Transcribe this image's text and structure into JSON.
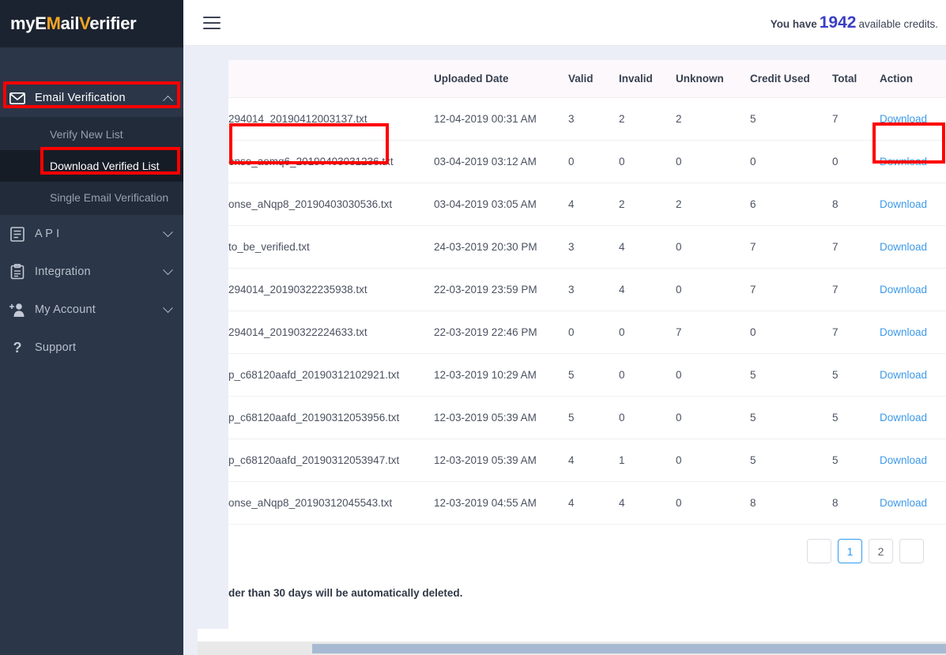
{
  "brand": {
    "logo_part1": "myE",
    "logo_accent1": "M",
    "logo_part2": "ail",
    "logo_accent2": "V",
    "logo_part3": "erifier",
    "logo_full": "myEMailVerifier"
  },
  "sidebar": {
    "items": [
      {
        "label": "Email Verification",
        "icon": "mail-icon",
        "caret": "chevron-up-icon",
        "expanded": true
      },
      {
        "label": "A P I",
        "icon": "document-icon",
        "caret": "chevron-down-icon",
        "expanded": false
      },
      {
        "label": "Integration",
        "icon": "clipboard-icon",
        "caret": "chevron-down-icon",
        "expanded": false
      },
      {
        "label": "My Account",
        "icon": "add-user-icon",
        "caret": "chevron-down-icon",
        "expanded": false
      },
      {
        "label": "Support",
        "icon": "question-mark-icon",
        "caret": "",
        "expanded": false
      }
    ],
    "submenu": [
      {
        "label": "Verify New List",
        "selected": false
      },
      {
        "label": "Download Verified List",
        "selected": true
      },
      {
        "label": "Single Email Verification",
        "selected": false
      }
    ]
  },
  "topbar": {
    "menu_icon": "hamburger-icon",
    "credits_prefix": "You have",
    "credits_count": "1942",
    "credits_suffix": "available credits."
  },
  "table": {
    "columns": [
      "",
      "Uploaded Date",
      "Valid",
      "Invalid",
      "Unknown",
      "Credit Used",
      "Total",
      "Action"
    ],
    "action_label": "Download",
    "rows": [
      {
        "file": "294014_20190412003137.txt",
        "date": "12-04-2019 00:31 AM",
        "valid": "3",
        "invalid": "2",
        "unknown": "2",
        "credit_used": "5",
        "total": "7",
        "action": "Download"
      },
      {
        "file": "onse_aemq6_20190403031236.txt",
        "date": "03-04-2019 03:12 AM",
        "valid": "0",
        "invalid": "0",
        "unknown": "0",
        "credit_used": "0",
        "total": "0",
        "action": "Download"
      },
      {
        "file": "onse_aNqp8_20190403030536.txt",
        "date": "03-04-2019 03:05 AM",
        "valid": "4",
        "invalid": "2",
        "unknown": "2",
        "credit_used": "6",
        "total": "8",
        "action": "Download"
      },
      {
        "file": "to_be_verified.txt",
        "date": "24-03-2019 20:30 PM",
        "valid": "3",
        "invalid": "4",
        "unknown": "0",
        "credit_used": "7",
        "total": "7",
        "action": "Download"
      },
      {
        "file": "294014_20190322235938.txt",
        "date": "22-03-2019 23:59 PM",
        "valid": "3",
        "invalid": "4",
        "unknown": "0",
        "credit_used": "7",
        "total": "7",
        "action": "Download"
      },
      {
        "file": "294014_20190322224633.txt",
        "date": "22-03-2019 22:46 PM",
        "valid": "0",
        "invalid": "0",
        "unknown": "7",
        "credit_used": "0",
        "total": "7",
        "action": "Download"
      },
      {
        "file": "p_c68120aafd_20190312102921.txt",
        "date": "12-03-2019 10:29 AM",
        "valid": "5",
        "invalid": "0",
        "unknown": "0",
        "credit_used": "5",
        "total": "5",
        "action": "Download"
      },
      {
        "file": "p_c68120aafd_20190312053956.txt",
        "date": "12-03-2019 05:39 AM",
        "valid": "5",
        "invalid": "0",
        "unknown": "0",
        "credit_used": "5",
        "total": "5",
        "action": "Download"
      },
      {
        "file": "p_c68120aafd_20190312053947.txt",
        "date": "12-03-2019 05:39 AM",
        "valid": "4",
        "invalid": "1",
        "unknown": "0",
        "credit_used": "5",
        "total": "5",
        "action": "Download"
      },
      {
        "file": "onse_aNqp8_20190312045543.txt",
        "date": "12-03-2019 04:55 AM",
        "valid": "4",
        "invalid": "4",
        "unknown": "0",
        "credit_used": "8",
        "total": "8",
        "action": "Download"
      }
    ]
  },
  "pagination": {
    "prev_label": "",
    "pages": [
      "1",
      "2"
    ],
    "active_page": "1",
    "next_label": ""
  },
  "note": "der than 30 days will be automatically deleted.",
  "colors": {
    "sidebar_bg": "#2b3648",
    "sidebar_logo_bg": "#1c2330",
    "submenu_bg": "#222b3a",
    "submenu_selected_bg": "#161c26",
    "logo_accent": "#f5a623",
    "credits_number": "#3b3fc4",
    "link_blue": "#3d9ae8",
    "pagination_active": "#2e9bf0",
    "annotation_red": "#ff0000",
    "content_bg": "#eceef7",
    "table_header_bg": "#fdf8fc",
    "scrollbar_thumb": "#a7bad2"
  }
}
